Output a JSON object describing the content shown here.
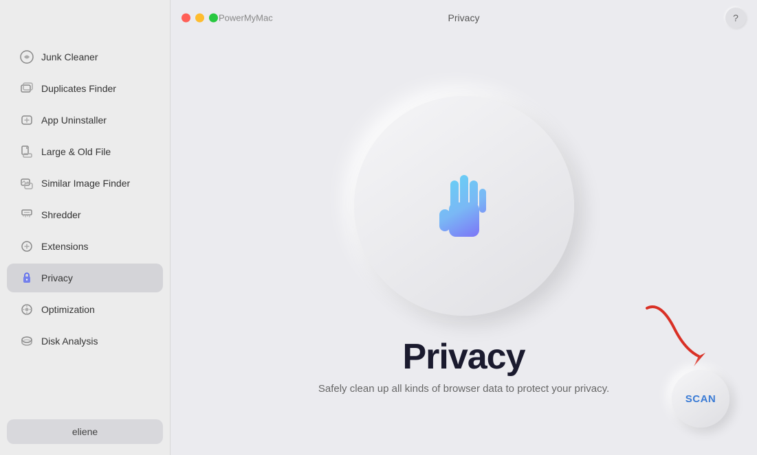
{
  "app": {
    "name": "PowerMyMac",
    "title": "Privacy"
  },
  "titlebar": {
    "label": "Privacy",
    "help": "?"
  },
  "sidebar": {
    "items": [
      {
        "id": "junk-cleaner",
        "label": "Junk Cleaner",
        "active": false
      },
      {
        "id": "duplicates-finder",
        "label": "Duplicates Finder",
        "active": false
      },
      {
        "id": "app-uninstaller",
        "label": "App Uninstaller",
        "active": false
      },
      {
        "id": "large-old-file",
        "label": "Large & Old File",
        "active": false
      },
      {
        "id": "similar-image-finder",
        "label": "Similar Image Finder",
        "active": false
      },
      {
        "id": "shredder",
        "label": "Shredder",
        "active": false
      },
      {
        "id": "extensions",
        "label": "Extensions",
        "active": false
      },
      {
        "id": "privacy",
        "label": "Privacy",
        "active": true
      },
      {
        "id": "optimization",
        "label": "Optimization",
        "active": false
      },
      {
        "id": "disk-analysis",
        "label": "Disk Analysis",
        "active": false
      }
    ],
    "user": "eliene"
  },
  "main": {
    "page_title": "Privacy",
    "page_subtitle": "Safely clean up all kinds of browser data to protect your privacy.",
    "scan_label": "SCAN"
  }
}
